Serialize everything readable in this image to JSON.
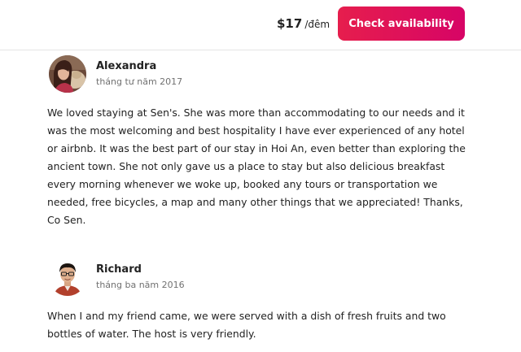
{
  "header": {
    "price": "$17",
    "price_unit": "/đêm",
    "check_button_label": "Check availability",
    "brand_color": "#e61e4d"
  },
  "reviews": [
    {
      "name": "Alexandra",
      "date": "tháng tư năm 2017",
      "text": "We loved staying at Sen's. She was more than accommodating to our needs and it was the most welcoming and best hospitality I have ever experienced of any hotel or airbnb. It was the best part of our stay in Hoi An, even better than exploring the ancient town. She not only gave us a place to stay but also delicious breakfast every morning whenever we woke up, booked any tours or transportation we needed, free bicycles, a map and many other things that we appreciated! Thanks, Co Sen."
    },
    {
      "name": "Richard",
      "date": "tháng ba năm 2016",
      "text": "When I and my friend came, we were served with a dish of fresh fruits and two bottles of water. The host is very friendly."
    }
  ]
}
